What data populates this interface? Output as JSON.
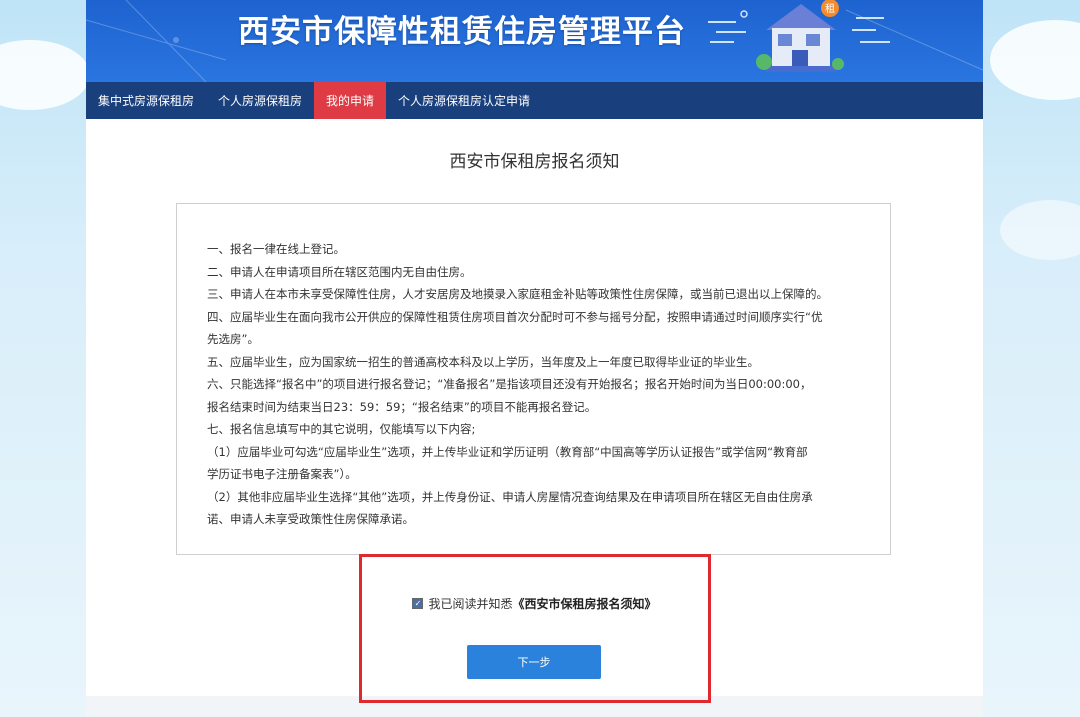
{
  "header": {
    "title": "西安市保障性租赁住房管理平台",
    "house_badge": "租"
  },
  "nav": {
    "items": [
      {
        "label": "集中式房源保租房",
        "active": false
      },
      {
        "label": "个人房源保租房",
        "active": false
      },
      {
        "label": "我的申请",
        "active": true
      },
      {
        "label": "个人房源保租房认定申请",
        "active": false
      }
    ]
  },
  "main": {
    "title": "西安市保租房报名须知",
    "notice_lines": [
      "一、报名一律在线上登记。",
      "二、申请人在申请项目所在辖区范围内无自由住房。",
      "三、申请人在本市未享受保障性住房，人才安居房及地摸录入家庭租金补贴等政策性住房保障，或当前已退出以上保障的。",
      "四、应届毕业生在面向我市公开供应的保障性租赁住房项目首次分配时可不参与摇号分配，按照申请通过时间顺序实行“优",
      "先选房”。",
      "五、应届毕业生，应为国家统一招生的普通高校本科及以上学历，当年度及上一年度已取得毕业证的毕业生。",
      "六、只能选择“报名中”的项目进行报名登记；“准备报名”是指该项目还没有开始报名；报名开始时间为当日00:00:00，",
      "报名结束时间为结束当日23：59：59；“报名结束”的项目不能再报名登记。",
      "七、报名信息填写中的其它说明，仅能填写以下内容;",
      "（1）应届毕业可勾选“应届毕业生”选项，并上传毕业证和学历证明（教育部“中国高等学历认证报告”或学信网“教育部",
      "学历证书电子注册备案表”）。",
      "（2）其他非应届毕业生选择“其他”选项，并上传身份证、申请人房屋情况查询结果及在申请项目所在辖区无自由住房承",
      "诺、申请人未享受政策性住房保障承诺。"
    ],
    "confirm_prefix": "我已阅读并知悉",
    "confirm_doc": "《西安市保租房报名须知》",
    "confirm_checked": true,
    "next_button": "下一步"
  },
  "colors": {
    "header_blue": "#1e63d0",
    "nav_bg": "#193f7d",
    "nav_active": "#de3b45",
    "button_blue": "#2b82dc",
    "highlight_red": "#e0282f"
  }
}
